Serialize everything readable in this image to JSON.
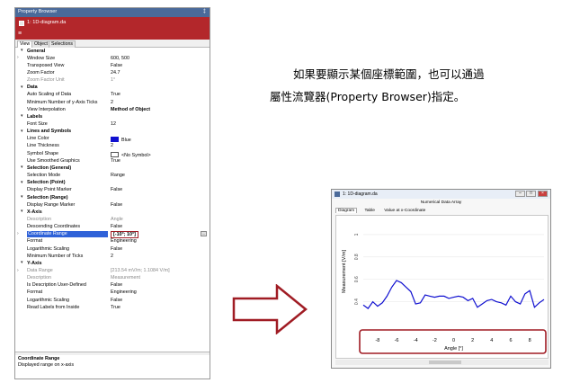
{
  "panel": {
    "title": "Property Browser",
    "pin_glyph": "‡",
    "doc_name": "1: 1D-diagram.da",
    "tabs": [
      {
        "label": "View",
        "active": true
      },
      {
        "label": "Object",
        "active": false
      },
      {
        "label": "Selections",
        "active": false
      }
    ],
    "rows": [
      {
        "kind": "cat",
        "name": "General"
      },
      {
        "kind": "prop",
        "name": "Window Size",
        "value": "600, 500",
        "arrow": ">"
      },
      {
        "kind": "prop",
        "name": "Transposed View",
        "value": "False"
      },
      {
        "kind": "prop",
        "name": "Zoom Factor",
        "value": "24.7"
      },
      {
        "kind": "dis",
        "name": "Zoom Factor Unit",
        "value": "1°"
      },
      {
        "kind": "cat",
        "name": "Data"
      },
      {
        "kind": "prop",
        "name": "Auto Scaling of Data",
        "value": "True"
      },
      {
        "kind": "prop",
        "name": "Minimum Number of y-Axis Ticks",
        "value": "2"
      },
      {
        "kind": "prop",
        "name": "View Interpolation",
        "value": "Method of Object",
        "bold": true
      },
      {
        "kind": "cat",
        "name": "Labels"
      },
      {
        "kind": "prop",
        "name": "Font Size",
        "value": "12"
      },
      {
        "kind": "cat",
        "name": "Lines and Symbols"
      },
      {
        "kind": "prop",
        "name": "Line Color",
        "value": "Blue",
        "swatch": "#1010d0"
      },
      {
        "kind": "prop",
        "name": "Line Thickness",
        "value": "2"
      },
      {
        "kind": "prop",
        "name": "Symbol Shape",
        "value": "<No Symbol>",
        "swatch": "#ffffff"
      },
      {
        "kind": "prop",
        "name": "Use Smoothed Graphics",
        "value": "True"
      },
      {
        "kind": "cat",
        "name": "Selection (General)"
      },
      {
        "kind": "prop",
        "name": "Selection Mode",
        "value": "Range"
      },
      {
        "kind": "cat",
        "name": "Selection (Point)"
      },
      {
        "kind": "prop",
        "name": "Display Point Marker",
        "value": "False"
      },
      {
        "kind": "cat",
        "name": "Selection (Range)"
      },
      {
        "kind": "prop",
        "name": "Display Range Marker",
        "value": "False"
      },
      {
        "kind": "cat",
        "name": "X-Axis"
      },
      {
        "kind": "dis",
        "name": "Description",
        "value": "Angle"
      },
      {
        "kind": "prop",
        "name": "Descending Coordinates",
        "value": "False"
      },
      {
        "kind": "sel",
        "name": "Coordinate Range",
        "value": "[-10°; 10°]",
        "arrow": ">"
      },
      {
        "kind": "prop",
        "name": "Format",
        "value": "Engineering"
      },
      {
        "kind": "prop",
        "name": "Logarithmic Scaling",
        "value": "False"
      },
      {
        "kind": "prop",
        "name": "Minimum Number of Ticks",
        "value": "2"
      },
      {
        "kind": "cat",
        "name": "Y-Axis"
      },
      {
        "kind": "dis",
        "name": "Data Range",
        "value": "[213.54 mV/m; 1.1084 V/m]",
        "arrow": ">"
      },
      {
        "kind": "dis",
        "name": "Description",
        "value": "Measurement"
      },
      {
        "kind": "prop",
        "name": "Is Description User-Defined",
        "value": "False"
      },
      {
        "kind": "prop",
        "name": "Format",
        "value": "Engineering"
      },
      {
        "kind": "prop",
        "name": "Logarithmic Scaling",
        "value": "False"
      },
      {
        "kind": "prop",
        "name": "Read Labels from Inside",
        "value": "True"
      }
    ],
    "desc_title": "Coordinate Range",
    "desc_text": "Displayed range on x-axis",
    "ellipsis": "..."
  },
  "caption": {
    "line1": "如果要顯示某個座標範圍，也可以通過",
    "line2": "屬性流覽器(Property Browser)指定。"
  },
  "window": {
    "title": "1: 1D-diagram.da",
    "heading": "Numerical Data Array",
    "tabs": [
      {
        "label": "Diagram",
        "active": true
      },
      {
        "label": "Table",
        "active": false
      },
      {
        "label": "Value at x-Coordinate",
        "active": false
      }
    ],
    "btn_min": "–",
    "btn_max": "□",
    "btn_close": "×"
  },
  "colors": {
    "accent_red": "#b3272b",
    "highlight_red": "#a01c24",
    "curve_blue": "#1010d0"
  },
  "chart_data": {
    "type": "line",
    "xlabel": "Angle [°]",
    "ylabel": "Measurement [V/m]",
    "xlim": [
      -9.5,
      9.5
    ],
    "ylim": [
      0.22,
      1.12
    ],
    "xticks": [
      -8,
      -6,
      -4,
      -2,
      0,
      2,
      4,
      6,
      8
    ],
    "yticks": [
      0.4,
      0.6,
      0.8,
      1
    ],
    "x": [
      -9.5,
      -9.0,
      -8.5,
      -8.0,
      -7.5,
      -7.0,
      -6.5,
      -6.0,
      -5.5,
      -5.0,
      -4.5,
      -4.0,
      -3.5,
      -3.0,
      -2.5,
      -2.0,
      -1.5,
      -1.0,
      -0.5,
      0.0,
      0.5,
      1.0,
      1.5,
      2.0,
      2.5,
      3.0,
      3.5,
      4.0,
      4.5,
      5.0,
      5.5,
      6.0,
      6.5,
      7.0,
      7.5,
      8.0,
      8.5,
      9.0,
      9.5
    ],
    "y": [
      0.37,
      0.34,
      0.4,
      0.36,
      0.39,
      0.45,
      0.53,
      0.59,
      0.57,
      0.53,
      0.49,
      0.38,
      0.39,
      0.46,
      0.45,
      0.44,
      0.45,
      0.45,
      0.43,
      0.44,
      0.45,
      0.44,
      0.41,
      0.43,
      0.35,
      0.38,
      0.41,
      0.42,
      0.4,
      0.39,
      0.37,
      0.45,
      0.4,
      0.38,
      0.47,
      0.5,
      0.35,
      0.39,
      0.42
    ]
  }
}
